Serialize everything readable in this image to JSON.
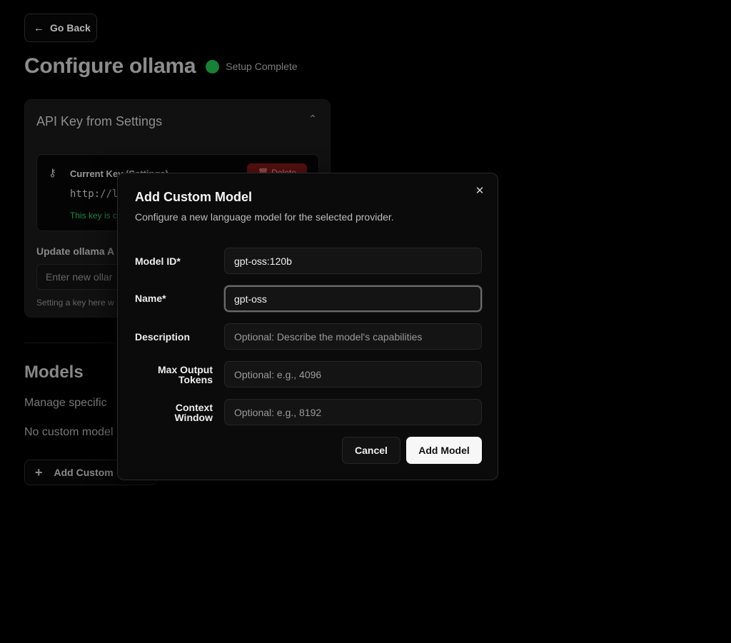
{
  "page": {
    "back_label": "Go Back",
    "title": "Configure ollama",
    "status_text": "Setup Complete",
    "status_color": "#1a7f37"
  },
  "api_card": {
    "title": "API Key from Settings",
    "current_key_label": "Current Key (Settings)",
    "current_key_value": "http://l",
    "key_note": "This key is c",
    "delete_label": "Delete",
    "update_label": "Update ollama A",
    "update_placeholder": "Enter new ollar",
    "update_hint": "Setting a key here w"
  },
  "models": {
    "title": "Models",
    "subtitle": "Manage specific",
    "empty_text": "No custom model",
    "add_label": "Add Custom"
  },
  "modal": {
    "title": "Add Custom Model",
    "description": "Configure a new language model for the selected provider.",
    "fields": {
      "model_id": {
        "label": "Model ID*",
        "value": "gpt-oss:120b",
        "placeholder": ""
      },
      "name": {
        "label": "Name*",
        "value": "gpt-oss",
        "placeholder": ""
      },
      "description": {
        "label": "Description",
        "value": "",
        "placeholder": "Optional: Describe the model's capabilities"
      },
      "max_tokens": {
        "label_line1": "Max Output",
        "label_line2": "Tokens",
        "value": "",
        "placeholder": "Optional: e.g., 4096"
      },
      "context_window": {
        "label_line1": "Context",
        "label_line2": "Window",
        "value": "",
        "placeholder": "Optional: e.g., 8192"
      }
    },
    "cancel_label": "Cancel",
    "submit_label": "Add Model"
  }
}
